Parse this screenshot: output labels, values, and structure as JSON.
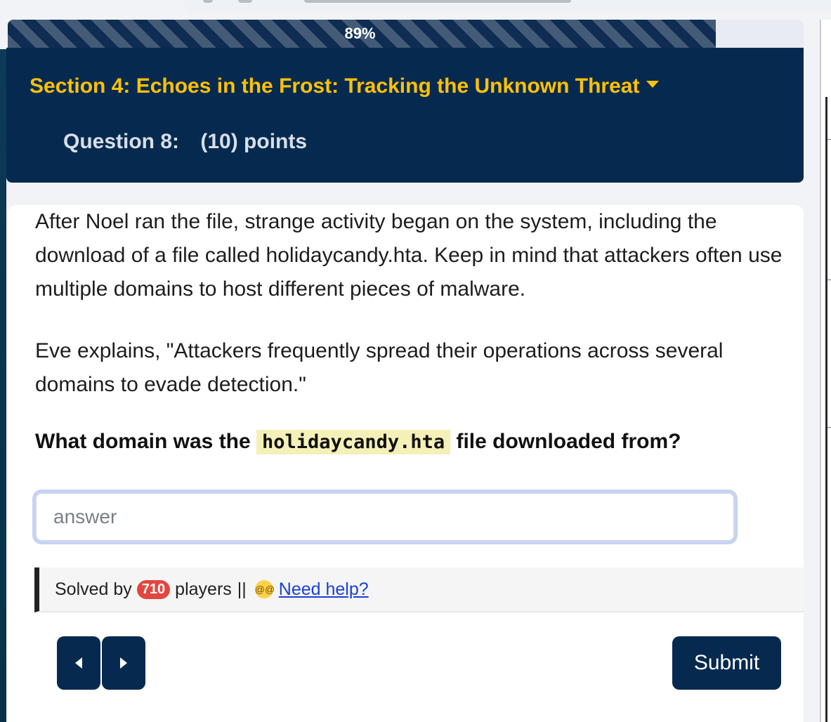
{
  "progress": {
    "label": "89%",
    "value": 0.89
  },
  "section": {
    "title": "Section 4: Echoes in the Frost: Tracking the Unknown Threat"
  },
  "question": {
    "label": "Question 8:",
    "points": "(10) points"
  },
  "content": {
    "paragraph1": "After Noel ran the file, strange activity began on the system, including the download of a file called holidaycandy.hta. Keep in mind that attackers often use multiple domains to host different pieces of malware.",
    "paragraph2": "Eve explains, \"Attackers frequently spread their operations across several domains to evade detection.\"",
    "prompt_before": "What domain was the ",
    "prompt_code": "holidaycandy.hta",
    "prompt_after": " file downloaded from?"
  },
  "answer": {
    "placeholder": "answer",
    "value": ""
  },
  "solved": {
    "prefix": "Solved by",
    "count": "710",
    "suffix": "players",
    "separator": "||",
    "help_link": "Need help?",
    "help_icon": "dizzy-face-emoji-icon"
  },
  "buttons": {
    "submit": "Submit",
    "prev_icon": "caret-left-icon",
    "next_icon": "caret-right-icon"
  },
  "colors": {
    "navy": "#062a4f",
    "accent": "#ffc107",
    "badge": "#e2463f",
    "link": "#1a3fd6",
    "code_bg": "#f4f0b8"
  }
}
